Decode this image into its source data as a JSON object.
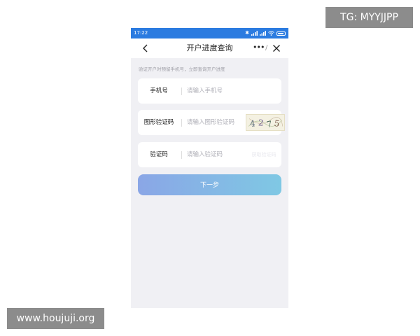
{
  "watermarks": {
    "top": "TG: MYYJJPP",
    "bottom": "www.houjuji.org"
  },
  "status_bar": {
    "time": "17:22",
    "icons": [
      "bluetooth-icon",
      "signal-icon",
      "signal-icon",
      "wifi-icon",
      "battery-icon"
    ],
    "bg_color": "#2b7be0"
  },
  "nav": {
    "title": "开户进度查询",
    "more": "•••",
    "separator": "/"
  },
  "hint": "验证开户时预留手机号，立即查询开户进度",
  "form": {
    "phone": {
      "label": "手机号",
      "placeholder": "请输入手机号"
    },
    "captcha": {
      "label": "图形验证码",
      "placeholder": "请输入图形验证码",
      "captcha_text": "4275"
    },
    "sms": {
      "label": "验证码",
      "placeholder": "请输入验证码",
      "send_label": "获取验证码"
    }
  },
  "next_button": {
    "label": "下一步",
    "gradient": [
      "#8aa6e6",
      "#7fc8e4"
    ]
  }
}
